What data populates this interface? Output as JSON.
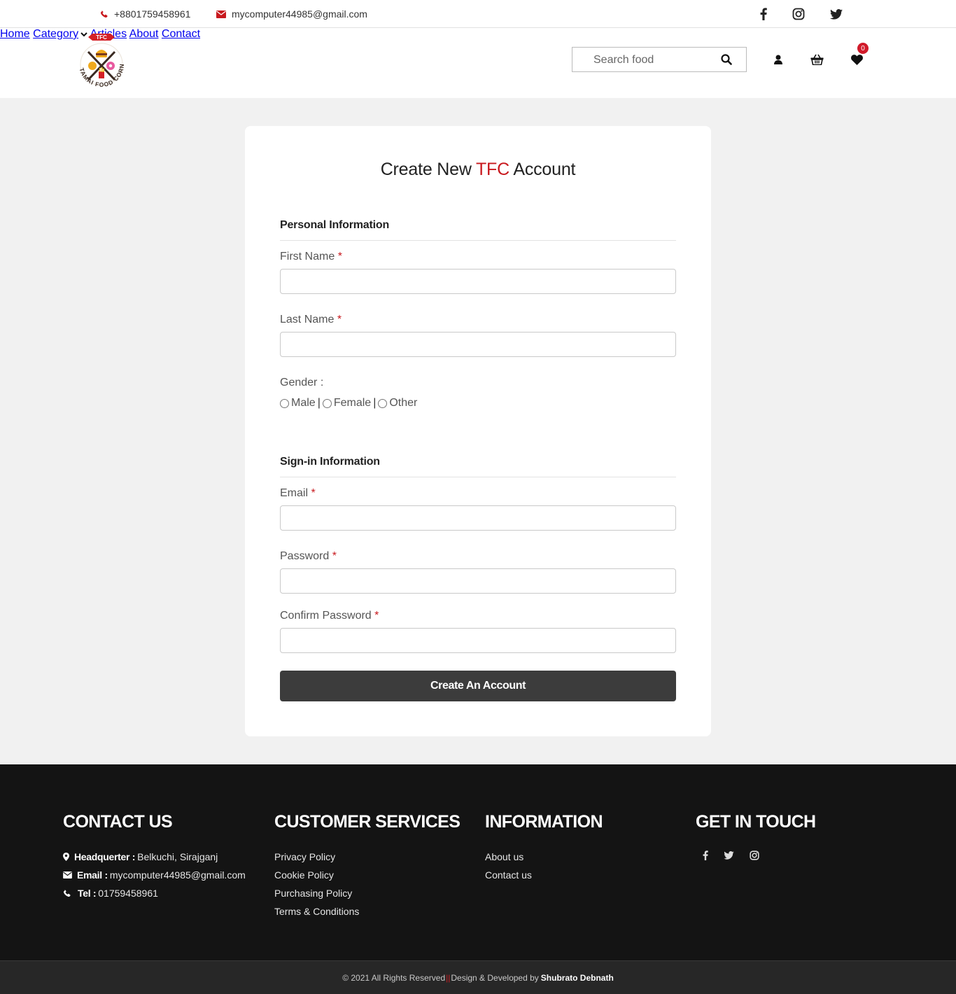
{
  "topbar": {
    "phone": "+8801759458961",
    "email": "mycomputer44985@gmail.com",
    "social_icons": [
      "facebook-icon",
      "instagram-icon",
      "twitter-icon"
    ]
  },
  "header": {
    "logo": {
      "top_text": "TFC",
      "ring_text": "TAMAI FOOD CORNER"
    },
    "nav": [
      "Home",
      "Category",
      "Articles",
      "About",
      "Contact"
    ],
    "search_placeholder": "Search food",
    "wishlist_count": "0"
  },
  "form": {
    "title_prefix": "Create New ",
    "title_brand": "TFC",
    "title_suffix": " Account",
    "personal_section": "Personal Information",
    "first_name_label": "First Name",
    "last_name_label": "Last Name",
    "gender_label": "Gender :",
    "gender_options": [
      "Male",
      "Female",
      "Other"
    ],
    "signin_section": "Sign-in Information",
    "email_label": "Email",
    "password_label": "Password",
    "confirm_password_label": "Confirm Password",
    "required_mark": "*",
    "submit_label": "Create An Account"
  },
  "footer": {
    "contact": {
      "title": "CONTACT US",
      "headquarter_label": "Headquerter :",
      "headquarter_value": "Belkuchi, Sirajganj",
      "email_label": "Email :",
      "email_value": "mycomputer44985@gmail.com",
      "tel_label": "Tel :",
      "tel_value": "01759458961"
    },
    "services": {
      "title": "CUSTOMER SERVICES",
      "links": [
        "Privacy Policy",
        "Cookie Policy",
        "Purchasing Policy",
        "Terms & Conditions"
      ]
    },
    "information": {
      "title": "INFORMATION",
      "links": [
        "About us",
        "Contact us"
      ]
    },
    "get_in_touch": {
      "title": "GET IN TOUCH"
    },
    "copyright": "© 2021 All Rights Reserved",
    "separator": "||",
    "credit": "Design & Developed by",
    "author": "Shubrato Debnath"
  },
  "colors": {
    "brand_red": "#c8191e",
    "footer_bg": "#141414",
    "button_bg": "#3c3c3c"
  }
}
